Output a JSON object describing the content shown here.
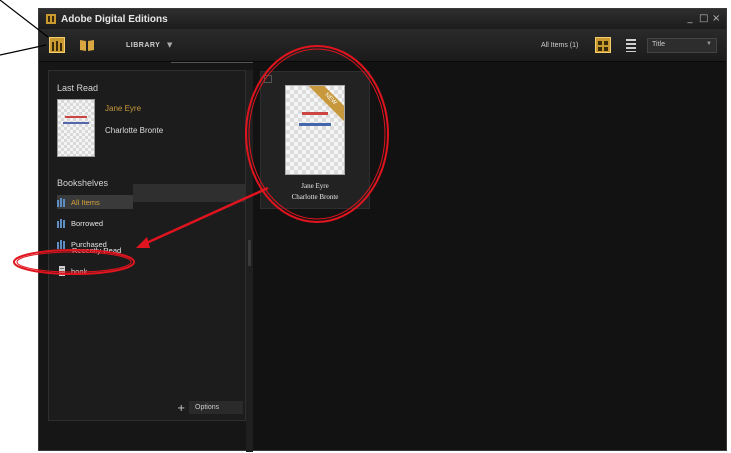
{
  "window": {
    "title": "Adobe Digital Editions",
    "controls": [
      "_",
      "□",
      "×"
    ]
  },
  "toolbar": {
    "library_label": "LIBRARY",
    "item_count": "All Items  (1)",
    "sort_value": "Title"
  },
  "sidebar": {
    "last_read_title": "Last Read",
    "last_read_book": {
      "title": "Jane Eyre",
      "author": "Charlotte Bronte"
    },
    "bookshelves_title": "Bookshelves",
    "shelves": [
      "All Items",
      "Borrowed",
      "Purchased",
      "Recently Read",
      "book"
    ],
    "options_label": "Options"
  },
  "content": {
    "books": [
      {
        "title": "Jane Eyre",
        "author": "Charlotte Bronte",
        "badge": "NEW"
      }
    ]
  },
  "colors": {
    "accent": "#c99a2f",
    "annotation": "#e0141e"
  }
}
